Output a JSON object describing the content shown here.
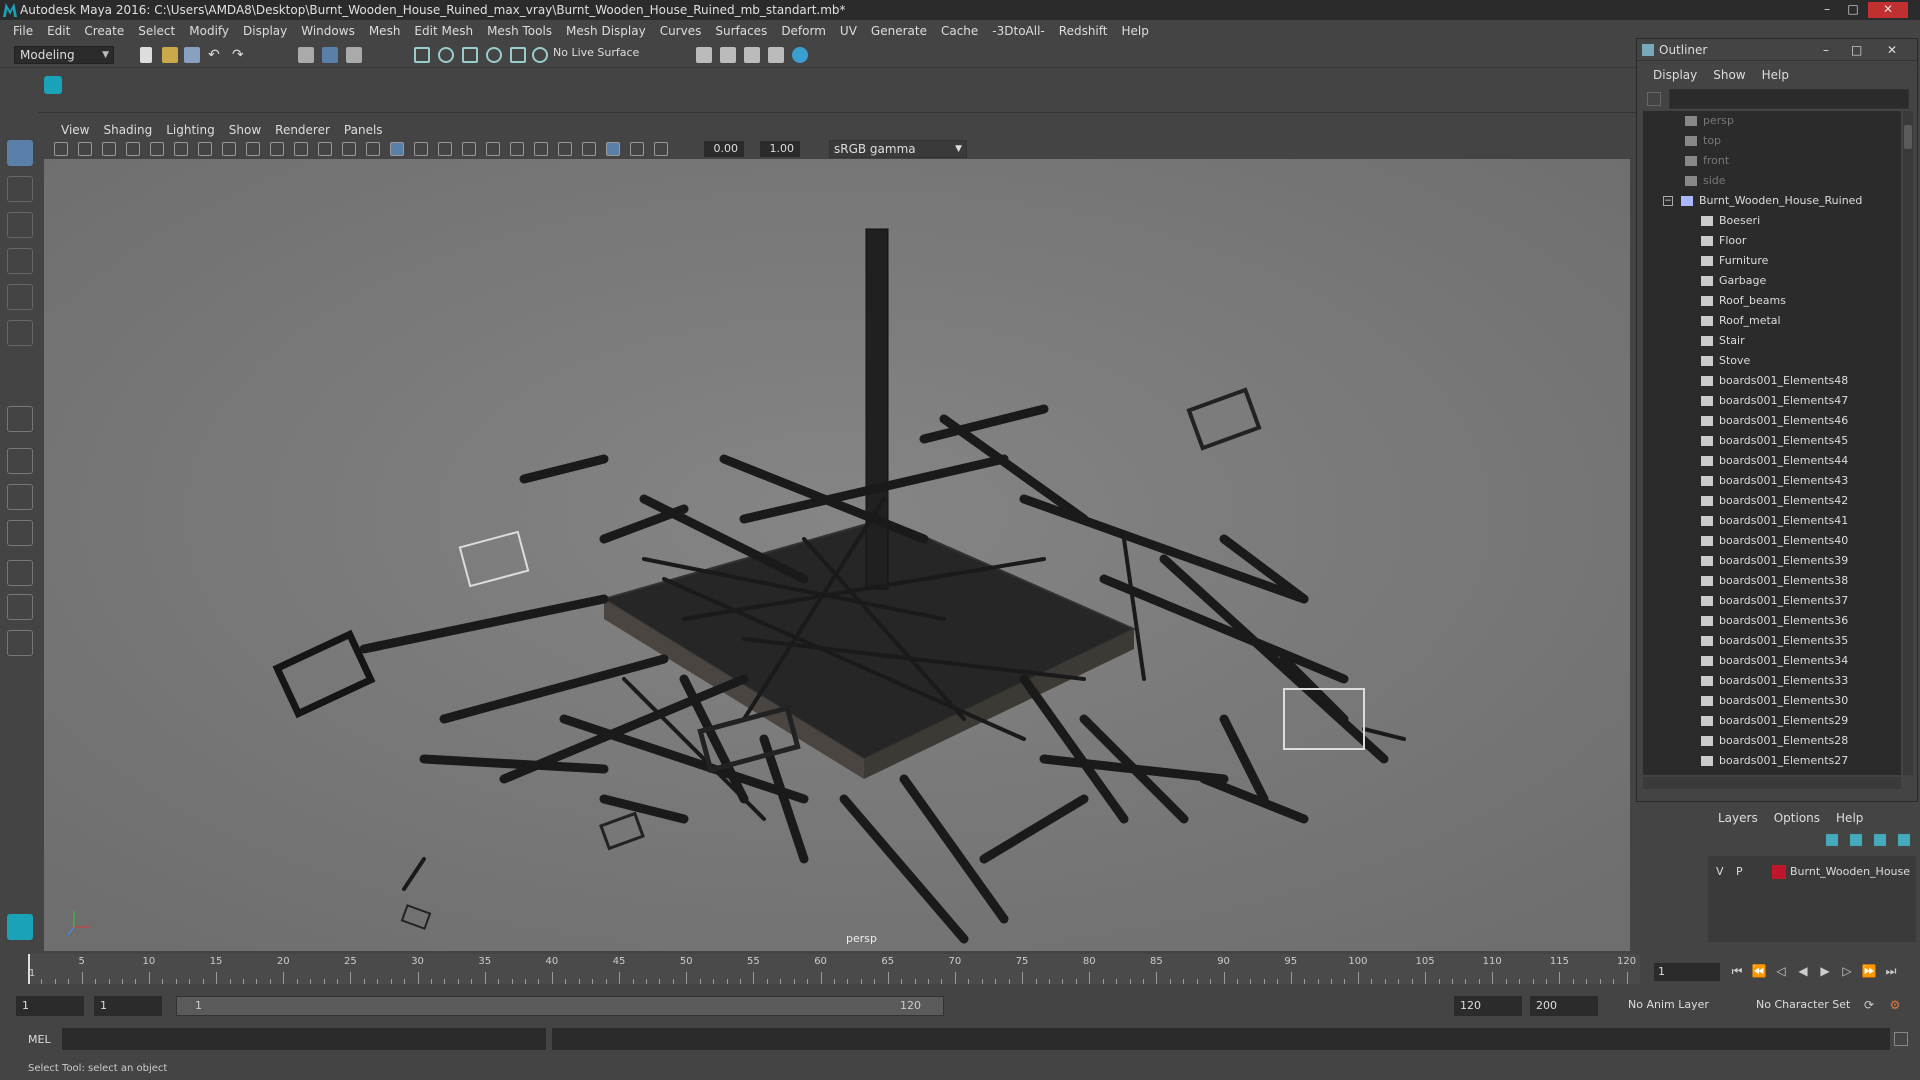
{
  "window": {
    "title": "Autodesk Maya 2016: C:\\Users\\AMDA8\\Desktop\\Burnt_Wooden_House_Ruined_max_vray\\Burnt_Wooden_House_Ruined_mb_standart.mb*",
    "minimize": "–",
    "maximize": "□",
    "close": "✕"
  },
  "menubar": [
    "File",
    "Edit",
    "Create",
    "Select",
    "Modify",
    "Display",
    "Windows",
    "Mesh",
    "Edit Mesh",
    "Mesh Tools",
    "Mesh Display",
    "Curves",
    "Surfaces",
    "Deform",
    "UV",
    "Generate",
    "Cache",
    "-3DtoAll-",
    "Redshift",
    "Help"
  ],
  "statusline": {
    "mode": "Modeling",
    "live_surface": "No Live Surface"
  },
  "viewport": {
    "menu": [
      "View",
      "Shading",
      "Lighting",
      "Show",
      "Renderer",
      "Panels"
    ],
    "exposure": "0.00",
    "gamma_value": "1.00",
    "color_space": "sRGB gamma",
    "camera": "persp"
  },
  "outliner": {
    "title": "Outliner",
    "menu": [
      "Display",
      "Show",
      "Help"
    ],
    "cameras": [
      "persp",
      "top",
      "front",
      "side"
    ],
    "group": "Burnt_Wooden_House_Ruined",
    "children": [
      "Boeseri",
      "Floor",
      "Furniture",
      "Garbage",
      "Roof_beams",
      "Roof_metal",
      "Stair",
      "Stove",
      "boards001_Elements48",
      "boards001_Elements47",
      "boards001_Elements46",
      "boards001_Elements45",
      "boards001_Elements44",
      "boards001_Elements43",
      "boards001_Elements42",
      "boards001_Elements41",
      "boards001_Elements40",
      "boards001_Elements39",
      "boards001_Elements38",
      "boards001_Elements37",
      "boards001_Elements36",
      "boards001_Elements35",
      "boards001_Elements34",
      "boards001_Elements33",
      "boards001_Elements30",
      "boards001_Elements29",
      "boards001_Elements28",
      "boards001_Elements27"
    ]
  },
  "layers": {
    "menu": [
      "Layers",
      "Options",
      "Help"
    ],
    "visible": "V",
    "playback": "P",
    "layer_name": "Burnt_Wooden_House",
    "layer_color": "#c0162b"
  },
  "timeline": {
    "ticks": [
      "5",
      "10",
      "15",
      "20",
      "25",
      "30",
      "35",
      "40",
      "45",
      "50",
      "55",
      "60",
      "65",
      "70",
      "75",
      "80",
      "85",
      "90",
      "95",
      "100",
      "105",
      "110",
      "115",
      "120"
    ],
    "first": "1",
    "current_frame": "1"
  },
  "range": {
    "start": "1",
    "playback_start": "1",
    "slider_start": "1",
    "slider_end": "120",
    "playback_end": "120",
    "end": "200",
    "anim_layer": "No Anim Layer",
    "character_set": "No Character Set"
  },
  "command": {
    "mel_label": "MEL",
    "help_line": "Select Tool: select an object"
  },
  "colors": {
    "accent": "#1aa3b8",
    "active_tool": "#5a7fa8"
  }
}
